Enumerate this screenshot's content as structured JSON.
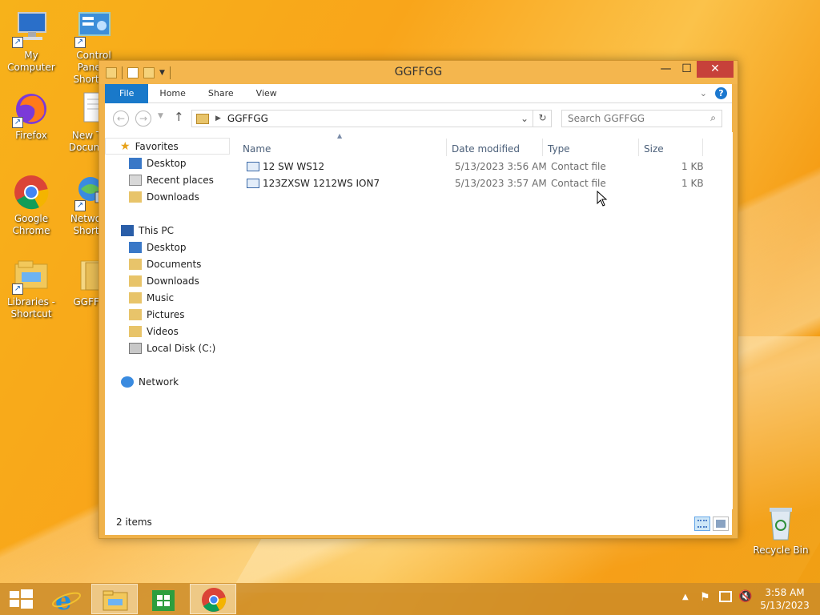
{
  "desktop": {
    "icons": [
      {
        "label": "My Computer",
        "icon": "computer-icon"
      },
      {
        "label": "Control Panel - Shortcut",
        "icon": "control-panel-icon"
      },
      {
        "label": "Firefox",
        "icon": "firefox-icon"
      },
      {
        "label": "New Text Document",
        "icon": "text-document-icon"
      },
      {
        "label": "Google Chrome",
        "icon": "chrome-icon"
      },
      {
        "label": "Network - Shortcut",
        "icon": "network-icon"
      },
      {
        "label": "Libraries - Shortcut",
        "icon": "libraries-icon"
      },
      {
        "label": "GGFFGG",
        "icon": "folder-icon"
      },
      {
        "label": "Recycle Bin",
        "icon": "recycle-bin-icon"
      }
    ]
  },
  "window": {
    "title": "GGFFGG",
    "tabs": [
      "File",
      "Home",
      "Share",
      "View"
    ],
    "address": {
      "crumb": "GGFFGG"
    },
    "search": {
      "placeholder": "Search GGFFGG"
    },
    "nav": {
      "favorites": "Favorites",
      "fav_items": [
        "Desktop",
        "Recent places",
        "Downloads"
      ],
      "this_pc": "This PC",
      "pc_items": [
        "Desktop",
        "Documents",
        "Downloads",
        "Music",
        "Pictures",
        "Videos",
        "Local Disk (C:)"
      ],
      "network": "Network"
    },
    "columns": [
      "Name",
      "Date modified",
      "Type",
      "Size"
    ],
    "files": [
      {
        "name": "12 SW WS12",
        "date": "5/13/2023 3:56 AM",
        "type": "Contact file",
        "size": "1 KB"
      },
      {
        "name": "123ZXSW 1212WS ION7",
        "date": "5/13/2023 3:57 AM",
        "type": "Contact file",
        "size": "1 KB"
      }
    ],
    "status": "2 items"
  },
  "taskbar": {
    "time": "3:58 AM",
    "date": "5/13/2023",
    "apps": [
      "internet-explorer-icon",
      "file-explorer-icon",
      "store-icon",
      "chrome-icon"
    ]
  },
  "colors": {
    "accent": "#1979ca",
    "wallpaper": "#f7b21a"
  }
}
